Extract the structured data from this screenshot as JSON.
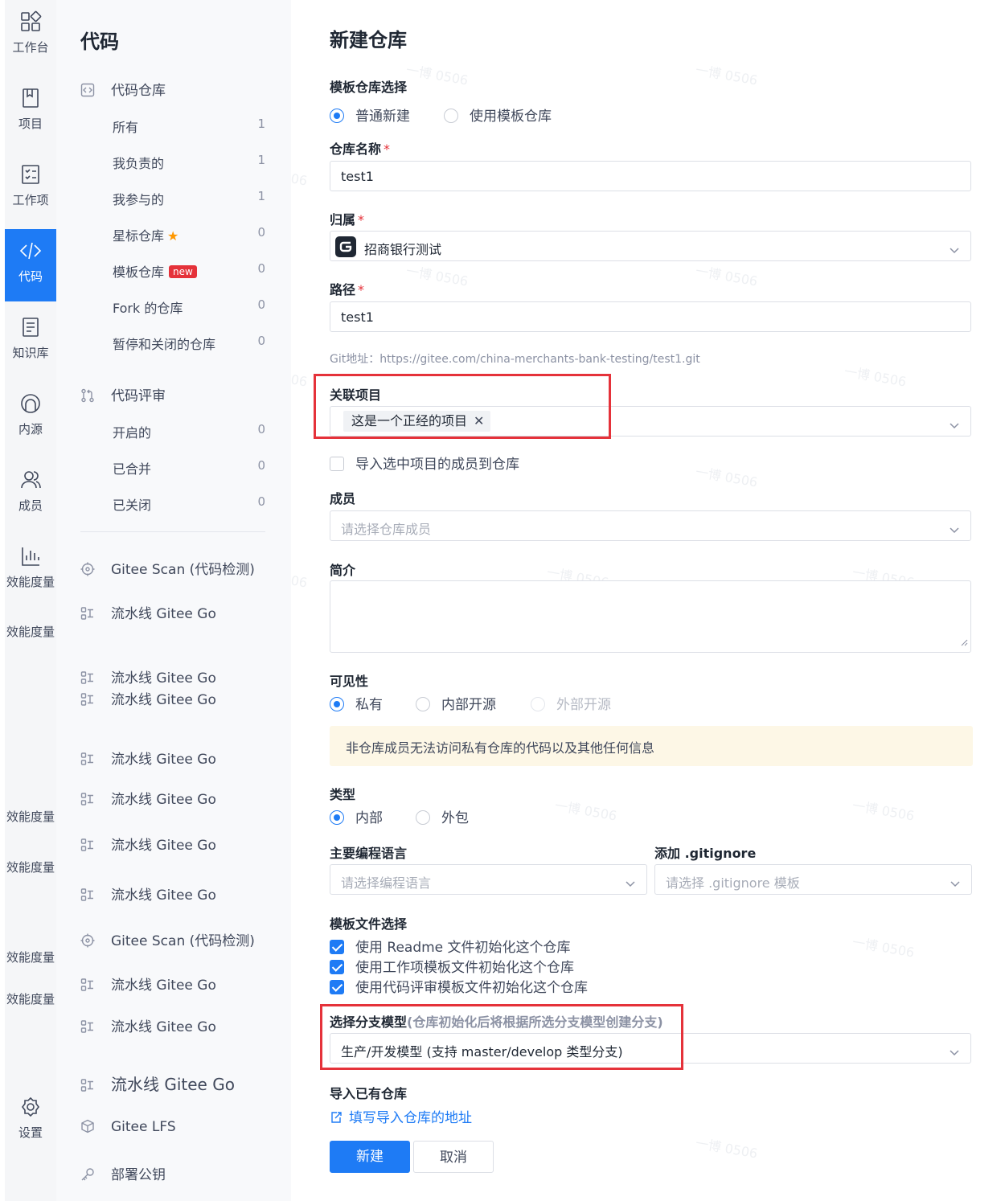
{
  "rail": {
    "items": [
      {
        "label": "工作台",
        "icon": "dashboard-icon"
      },
      {
        "label": "项目",
        "icon": "book-icon"
      },
      {
        "label": "工作项",
        "icon": "checklist-icon"
      },
      {
        "label": "代码",
        "icon": "code-icon"
      },
      {
        "label": "知识库",
        "icon": "document-icon"
      },
      {
        "label": "内源",
        "icon": "inner-source-icon"
      },
      {
        "label": "成员",
        "icon": "members-icon"
      },
      {
        "label": "效能度量",
        "icon": "chart-icon"
      },
      {
        "label": "设置",
        "icon": "gear-icon"
      }
    ],
    "fragments": [
      "效能度量",
      "效能度量",
      "效能度量",
      "效能度量",
      "效能度量"
    ]
  },
  "sidebar": {
    "title": "代码",
    "repo_group": "代码仓库",
    "repo_items": [
      {
        "label": "所有",
        "count": "1"
      },
      {
        "label": "我负责的",
        "count": "1"
      },
      {
        "label": "我参与的",
        "count": "1"
      },
      {
        "label": "星标仓库",
        "count": "0"
      },
      {
        "label": "模板仓库",
        "count": "0",
        "tag": "new"
      },
      {
        "label": "Fork 的仓库",
        "count": "0"
      },
      {
        "label": "暂停和关闭的仓库",
        "count": "0"
      }
    ],
    "review_group": "代码评审",
    "review_items": [
      {
        "label": "开启的",
        "count": "0"
      },
      {
        "label": "已合并",
        "count": "0"
      },
      {
        "label": "已关闭",
        "count": "0"
      }
    ],
    "tools": [
      {
        "label": "Gitee Scan (代码检测)"
      },
      {
        "label": "流水线 Gitee Go"
      },
      {
        "label": "流水线 Gitee Go"
      },
      {
        "label": "流水线 Gitee Go"
      },
      {
        "label": "流水线 Gitee Go"
      },
      {
        "label": "流水线 Gitee Go"
      },
      {
        "label": "流水线 Gitee Go"
      },
      {
        "label": "流水线 Gitee Go"
      },
      {
        "label": "Gitee Scan (代码检测)"
      },
      {
        "label": "流水线 Gitee Go"
      },
      {
        "label": "流水线 Gitee Go"
      },
      {
        "label": "流水线 Gitee Go"
      },
      {
        "label": "Gitee LFS"
      },
      {
        "label": "部署公钥"
      }
    ]
  },
  "form": {
    "title": "新建仓库",
    "template_label": "模板仓库选择",
    "template_options": [
      "普通新建",
      "使用模板仓库"
    ],
    "name_label": "仓库名称",
    "name_value": "test1",
    "owner_label": "归属",
    "owner_value": "招商银行测试",
    "path_label": "路径",
    "path_value": "test1",
    "git_url": "Git地址：https://gitee.com/china-merchants-bank-testing/test1.git",
    "project_label": "关联项目",
    "project_tag": "这是一个正经的项目",
    "import_members": "导入选中项目的成员到仓库",
    "members_label": "成员",
    "members_placeholder": "请选择仓库成员",
    "intro_label": "简介",
    "visibility_label": "可见性",
    "visibility_options": [
      "私有",
      "内部开源",
      "外部开源"
    ],
    "visibility_notice": "非仓库成员无法访问私有仓库的代码以及其他任何信息",
    "type_label": "类型",
    "type_options": [
      "内部",
      "外包"
    ],
    "lang_label": "主要编程语言",
    "lang_placeholder": "请选择编程语言",
    "gitignore_label": "添加 .gitignore",
    "gitignore_placeholder": "请选择 .gitignore 模板",
    "template_files_label": "模板文件选择",
    "template_files": [
      "使用 Readme 文件初始化这个仓库",
      "使用工作项模板文件初始化这个仓库",
      "使用代码评审模板文件初始化这个仓库"
    ],
    "branch_label": "选择分支模型",
    "branch_hint": "(仓库初始化后将根据所选分支模型创建分支)",
    "branch_value": "生产/开发模型 (支持 master/develop 类型分支)",
    "import_label": "导入已有仓库",
    "import_link": "填写导入仓库的地址",
    "create_button": "新建",
    "cancel_button": "取消"
  },
  "watermark": "一博 0506",
  "colors": {
    "accent": "#1e7bf5",
    "highlight": "#e5323a",
    "notice_bg": "#fdf7e6"
  }
}
